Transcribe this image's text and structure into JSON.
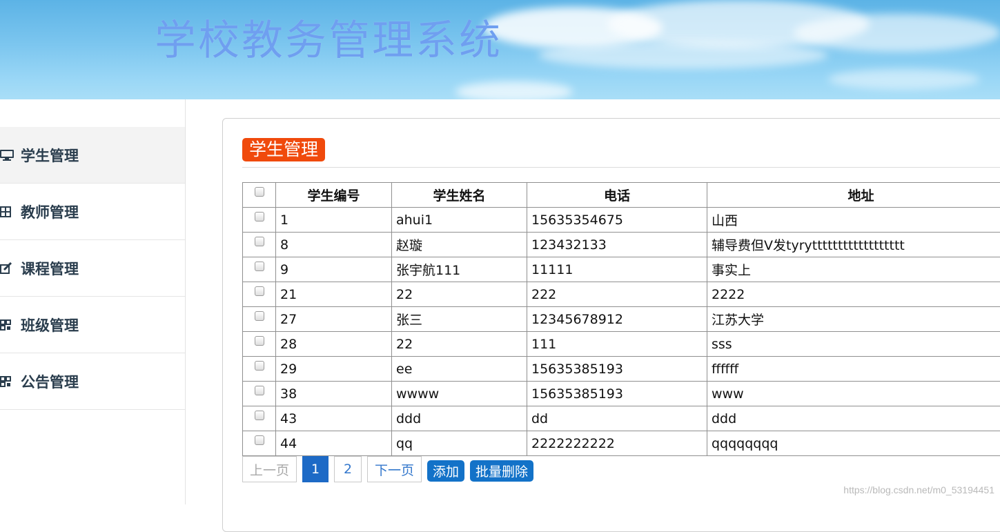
{
  "header": {
    "title": "学校教务管理系统"
  },
  "sidebar": {
    "items": [
      {
        "label": "学生管理",
        "icon": "monitor-icon",
        "active": true
      },
      {
        "label": "教师管理",
        "icon": "grid-icon",
        "active": false
      },
      {
        "label": "课程管理",
        "icon": "edit-icon",
        "active": false
      },
      {
        "label": "班级管理",
        "icon": "qr-icon",
        "active": false
      },
      {
        "label": "公告管理",
        "icon": "qr-icon",
        "active": false
      }
    ]
  },
  "main": {
    "title": "学生管理",
    "table": {
      "columns": [
        "学生编号",
        "学生姓名",
        "电话",
        "地址"
      ],
      "rows": [
        [
          "1",
          "ahui1",
          "15635354675",
          "山西"
        ],
        [
          "8",
          "赵璇",
          "123432133",
          "辅导费但V发tyrytttttttttttttttttt"
        ],
        [
          "9",
          "张宇航111",
          "11111",
          "事实上"
        ],
        [
          "21",
          "22",
          "222",
          "2222"
        ],
        [
          "27",
          "张三",
          "12345678912",
          "江苏大学"
        ],
        [
          "28",
          "22",
          "111",
          "sss"
        ],
        [
          "29",
          "ee",
          "15635385193",
          "ffffff"
        ],
        [
          "38",
          "wwww",
          "15635385193",
          "www"
        ],
        [
          "43",
          "ddd",
          "dd",
          "ddd"
        ],
        [
          "44",
          "qq",
          "2222222222",
          "qqqqqqqq"
        ]
      ]
    },
    "pager": {
      "prev": "上一页",
      "pages": [
        "1",
        "2"
      ],
      "current": "1",
      "next": "下一页"
    },
    "actions": {
      "add": "添加",
      "batch_delete": "批量删除"
    }
  },
  "watermark": "https://blog.csdn.net/m0_53194451",
  "colors": {
    "title_badge": "#f04a0c",
    "button": "#1372c8",
    "pager_current": "#1d6ac6"
  }
}
